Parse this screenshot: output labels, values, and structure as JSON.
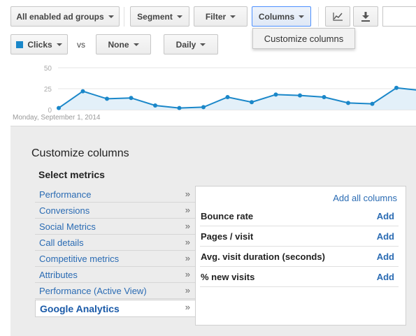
{
  "toolbar": {
    "ad_groups_label": "All enabled ad groups",
    "segment_label": "Segment",
    "filter_label": "Filter",
    "columns_label": "Columns"
  },
  "columns_menu": {
    "items": [
      "Customize columns"
    ]
  },
  "metric_selectors": {
    "primary_label": "Clicks",
    "primary_color": "#1a87c9",
    "vs_label": "vs",
    "secondary_label": "None",
    "granularity_label": "Daily"
  },
  "chart_data": {
    "type": "area",
    "y_ticks": [
      "50",
      "25",
      "0"
    ],
    "ylim": [
      0,
      50
    ],
    "values": [
      2,
      22,
      13,
      14,
      5,
      2,
      3,
      15,
      9,
      18,
      17,
      15,
      8,
      7,
      26,
      23
    ],
    "start_label": "Monday, September 1, 2014",
    "line_color": "#1a87c9",
    "fill_color": "#e3f0f9"
  },
  "customize": {
    "title": "Customize columns",
    "select_metrics_label": "Select metrics",
    "categories": [
      {
        "label": "Performance"
      },
      {
        "label": "Conversions"
      },
      {
        "label": "Social Metrics"
      },
      {
        "label": "Call details"
      },
      {
        "label": "Competitive metrics"
      },
      {
        "label": "Attributes"
      },
      {
        "label": "Performance (Active View)"
      },
      {
        "label": "Google Analytics"
      }
    ],
    "selected_category": "Google Analytics",
    "chevron": "»",
    "add_all_label": "Add all columns",
    "add_label": "Add",
    "metrics": [
      {
        "name": "Bounce rate"
      },
      {
        "name": "Pages / visit"
      },
      {
        "name": "Avg. visit duration (seconds)"
      },
      {
        "name": "% new visits"
      }
    ]
  }
}
